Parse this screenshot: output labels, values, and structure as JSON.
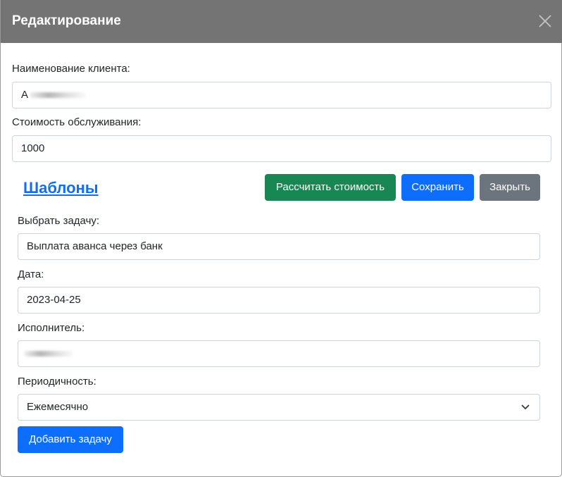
{
  "modal": {
    "title": "Редактирование"
  },
  "client_name": {
    "label": "Наименование клиента:",
    "value_visible": "А"
  },
  "service_cost": {
    "label": "Стоимость обслуживания:",
    "value": "1000"
  },
  "toolbar": {
    "templates_link": "Шаблоны",
    "calculate_label": "Рассчитать стоимость",
    "save_label": "Сохранить",
    "close_label": "Закрыть"
  },
  "task_form": {
    "task_label": "Выбрать задачу:",
    "task_value": "Выплата аванса через банк",
    "date_label": "Дата:",
    "date_value": "2023-04-25",
    "executor_label": "Исполнитель:",
    "periodicity_label": "Периодичность:",
    "periodicity_value": "Ежемесячно",
    "add_task_label": "Добавить задачу"
  },
  "colors": {
    "header_bg": "#747474",
    "success": "#198754",
    "primary": "#0d6efd",
    "secondary": "#6c757d",
    "link": "#0d6efd"
  },
  "icons": {
    "close": "close-icon",
    "dropdown": "chevron-down-icon"
  }
}
